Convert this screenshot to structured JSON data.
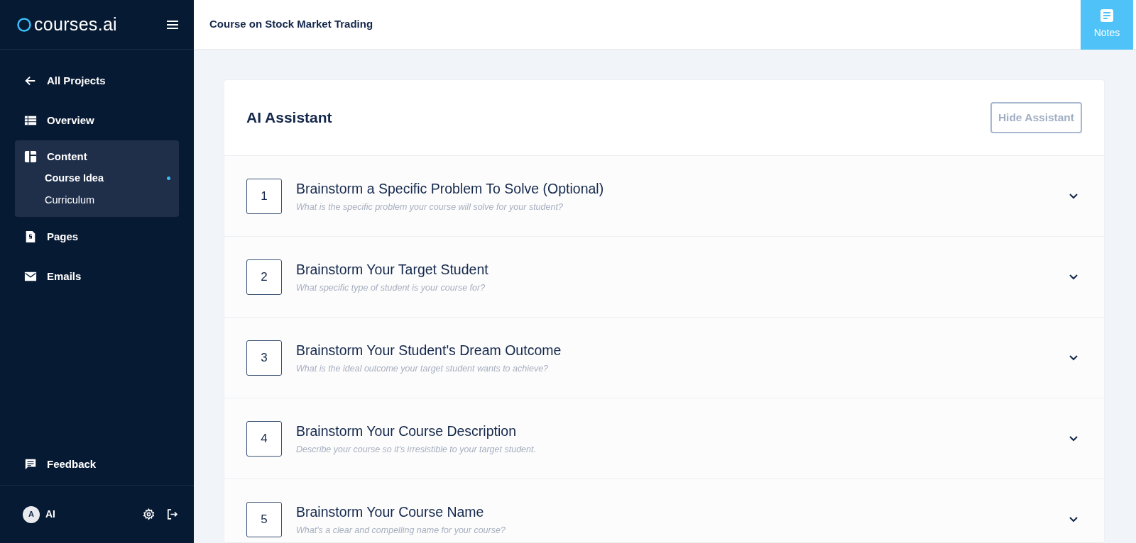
{
  "sidebar": {
    "logo": "courses.ai",
    "nav": [
      {
        "label": "All Projects",
        "selected": false
      },
      {
        "label": "Overview",
        "selected": false
      },
      {
        "label": "Content",
        "selected": true,
        "children": [
          {
            "label": "Course Idea",
            "selected": true
          },
          {
            "label": "Curriculum",
            "selected": false
          }
        ]
      },
      {
        "label": "Pages",
        "selected": false
      },
      {
        "label": "Emails",
        "selected": false
      }
    ],
    "feedback": "Feedback",
    "user": {
      "initial": "A",
      "name": "AI"
    }
  },
  "header": {
    "title": "Course on Stock Market Trading",
    "notes_button": "Notes"
  },
  "assistant": {
    "title": "AI Assistant",
    "hide_button": "Hide Assistant",
    "steps": [
      {
        "number": "1",
        "title": "Brainstorm a Specific Problem To Solve (Optional)",
        "hint": "What is the specific problem your course will solve for your student?",
        "expanded": false
      },
      {
        "number": "2",
        "title": "Brainstorm Your Target Student",
        "hint": "What specific type of student is your course for?",
        "expanded": false
      },
      {
        "number": "3",
        "title": "Brainstorm Your Student's Dream Outcome",
        "hint": "What is the ideal outcome your target student wants to achieve?",
        "expanded": false
      },
      {
        "number": "4",
        "title": "Brainstorm Your Course Description",
        "hint": "Describe your course so it's irresistible to your target student.",
        "expanded": false
      },
      {
        "number": "5",
        "title": "Brainstorm Your Course Name",
        "hint": "What's a clear and compelling name for your course?",
        "expanded": false
      }
    ]
  }
}
